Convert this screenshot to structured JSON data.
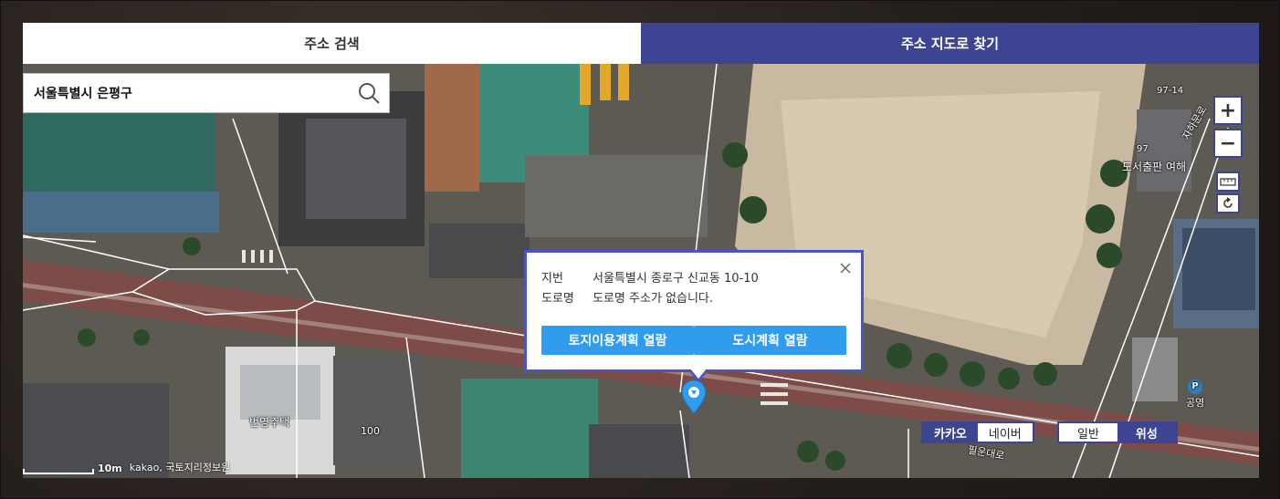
{
  "tabs": [
    {
      "label": "주소 검색",
      "active": false
    },
    {
      "label": "주소 지도로 찾기",
      "active": true
    }
  ],
  "search": {
    "value": "서울특별시 은평구",
    "icon": "search-icon"
  },
  "popup": {
    "rows": [
      {
        "key": "지번",
        "value": "서울특별시 종로구 신교동 10-10"
      },
      {
        "key": "도로명",
        "value": "도로명 주소가 없습니다."
      }
    ],
    "buttons": [
      "토지이용계획 열람",
      "도시계획 열람"
    ]
  },
  "map_provider": {
    "options": [
      "카카오",
      "네이버"
    ],
    "selected": "카카오"
  },
  "map_type": {
    "options": [
      "일반",
      "위성"
    ],
    "selected": "위성"
  },
  "zoom": {
    "plus": "+",
    "minus": "−"
  },
  "scale": {
    "distance": "10m",
    "copyright": "kakao, 국토지리정보원"
  },
  "map_labels": {
    "building_1": "번영주택",
    "building_num_1": "100",
    "address_num_1": "97-14",
    "address_num_2": "97",
    "shop_1": "도서출판 여해",
    "road_1": "자하문로",
    "road_2": "필운대로",
    "parking": "공영",
    "parking_icon": "P"
  },
  "colors": {
    "active_tab": "#3d4592",
    "popup_border": "#4a54c8",
    "popup_button": "#2f9cee",
    "marker": "#2f9cee"
  }
}
